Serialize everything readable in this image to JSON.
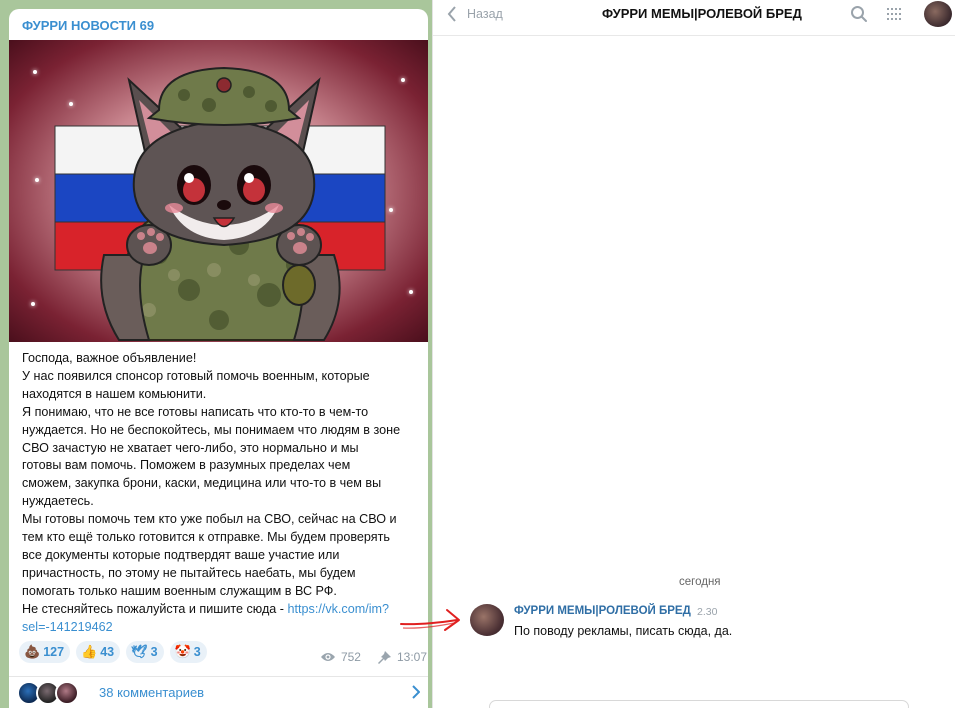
{
  "post": {
    "channel_name": "ФУРРИ НОВОСТИ 69",
    "lines": [
      "Господа, важное объявление!",
      "У нас появился спонсор готовый помочь военным, которые",
      "находятся в нашем комьюнити.",
      "Я понимаю, что не все готовы написать что кто-то в чем-то",
      "нуждается. Но не беспокойтесь, мы понимаем что людям в зоне",
      "СВО зачастую не хватает чего-либо, это нормально и мы",
      "готовы вам помочь. Поможем в разумных пределах чем",
      "сможем, закупка брони, каски, медицина или что-то в чем вы",
      "нуждаетесь.",
      "Мы готовы помочь тем кто уже побыл на СВО, сейчас на СВО и",
      "тем кто ещё только готовится к отправке. Мы будем проверять",
      "все документы которые подтвердят ваше участие или",
      "причастность, по этому не пытайтесь наебать, мы будем",
      "помогать только нашим военным служащим в ВС РФ."
    ],
    "last_line_prefix": "Не стесняйтесь пожалуйста и пишите сюда - ",
    "link_part1": "https://vk.com/im?",
    "link_part2": "sel=-141219462",
    "reactions": [
      {
        "emoji": "💩",
        "count": "127"
      },
      {
        "emoji": "👍",
        "count": "43"
      },
      {
        "emoji": "🕊",
        "count": "3"
      },
      {
        "emoji": "🤡",
        "count": "3"
      }
    ],
    "views": "752",
    "time": "13:07",
    "comments_label": "38 комментариев"
  },
  "chat": {
    "back_label": "Назад",
    "title": "ФУРРИ МЕМЫ|РОЛЕВОЙ БРЕД",
    "date_separator": "сегодня",
    "message": {
      "author": "ФУРРИ МЕМЫ|РОЛЕВОЙ БРЕД",
      "time": "2.30",
      "text": "По поводу рекламы, писать сюда, да."
    }
  },
  "colors": {
    "accent": "#3a8fd0",
    "author": "#2f6ea5",
    "arrow": "#e02020",
    "wallpaper": "#a9c69b"
  }
}
